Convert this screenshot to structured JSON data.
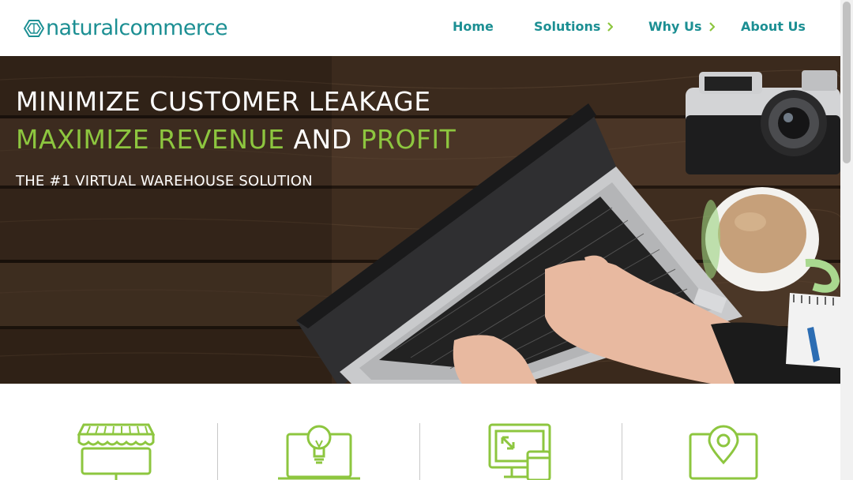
{
  "brand": {
    "part1": "natural",
    "part2": "commerce",
    "logo_color": "#1c8f93"
  },
  "nav": {
    "home": "Home",
    "solutions": "Solutions",
    "why_us": "Why Us",
    "about_us": "About Us"
  },
  "hero": {
    "line1": "MINIMIZE CUSTOMER LEAKAGE",
    "line2_a": "MAXIMIZE REVENUE",
    "line2_b": "AND",
    "line2_c": "PROFIT",
    "subtitle": "THE #1 VIRTUAL WAREHOUSE SOLUTION"
  },
  "colors": {
    "accent_green": "#8dc63f",
    "teal": "#1c8f93"
  },
  "features": [
    {
      "icon": "storefront-icon"
    },
    {
      "icon": "lightbulb-laptop-icon"
    },
    {
      "icon": "responsive-devices-icon"
    },
    {
      "icon": "location-pin-laptop-icon"
    }
  ]
}
